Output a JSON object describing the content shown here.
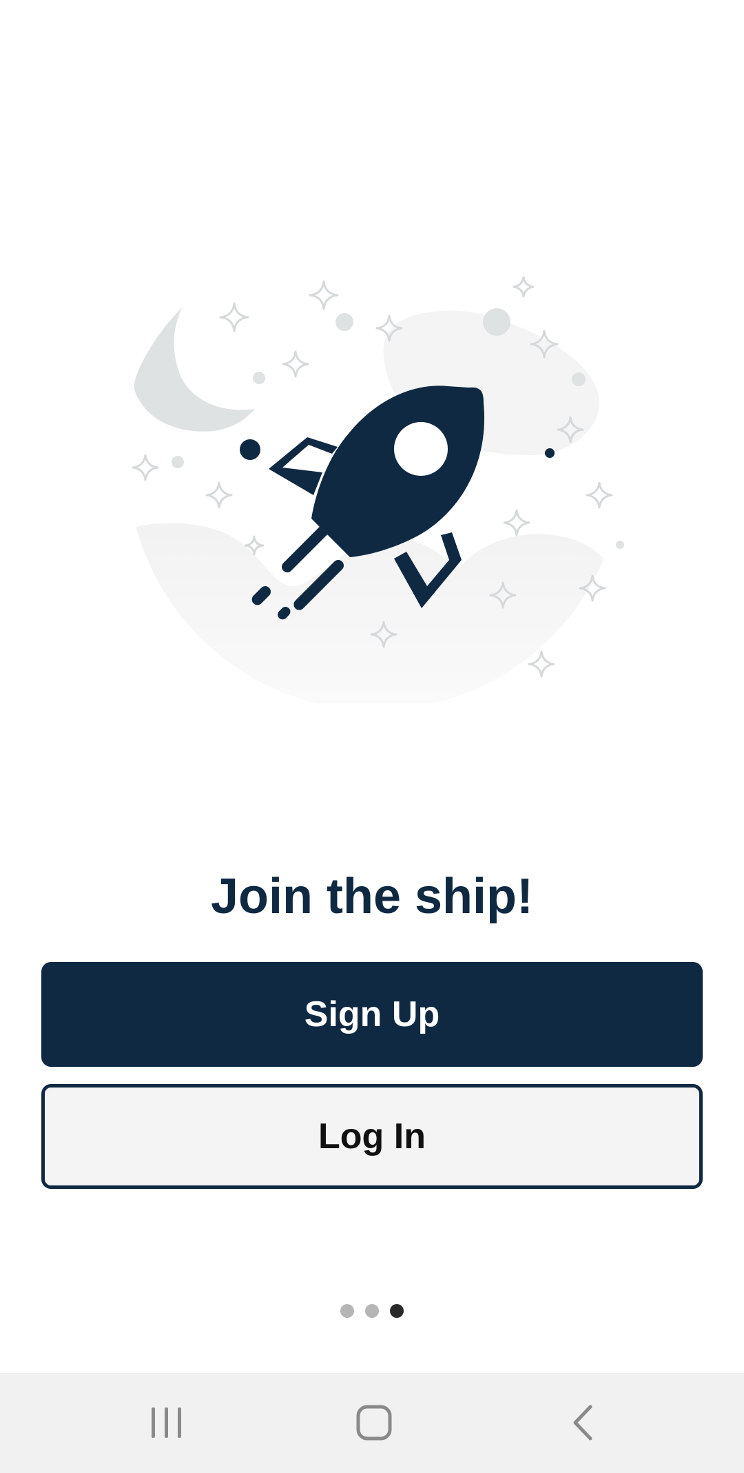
{
  "onboarding": {
    "headline": "Join the ship!",
    "signup_label": "Sign Up",
    "login_label": "Log In",
    "illustration_icon": "rocket-launch-illustration",
    "page_indicator": {
      "total": 3,
      "current": 3
    }
  },
  "navbar": {
    "recents_icon": "recents-icon",
    "home_icon": "home-icon",
    "back_icon": "back-icon"
  },
  "colors": {
    "primary": "#0f2942",
    "secondary_button_bg": "#f4f4f4",
    "navbar_bg": "#f1f1f1",
    "dot_inactive": "#b5b5b5",
    "dot_active": "#2a2a2a"
  }
}
